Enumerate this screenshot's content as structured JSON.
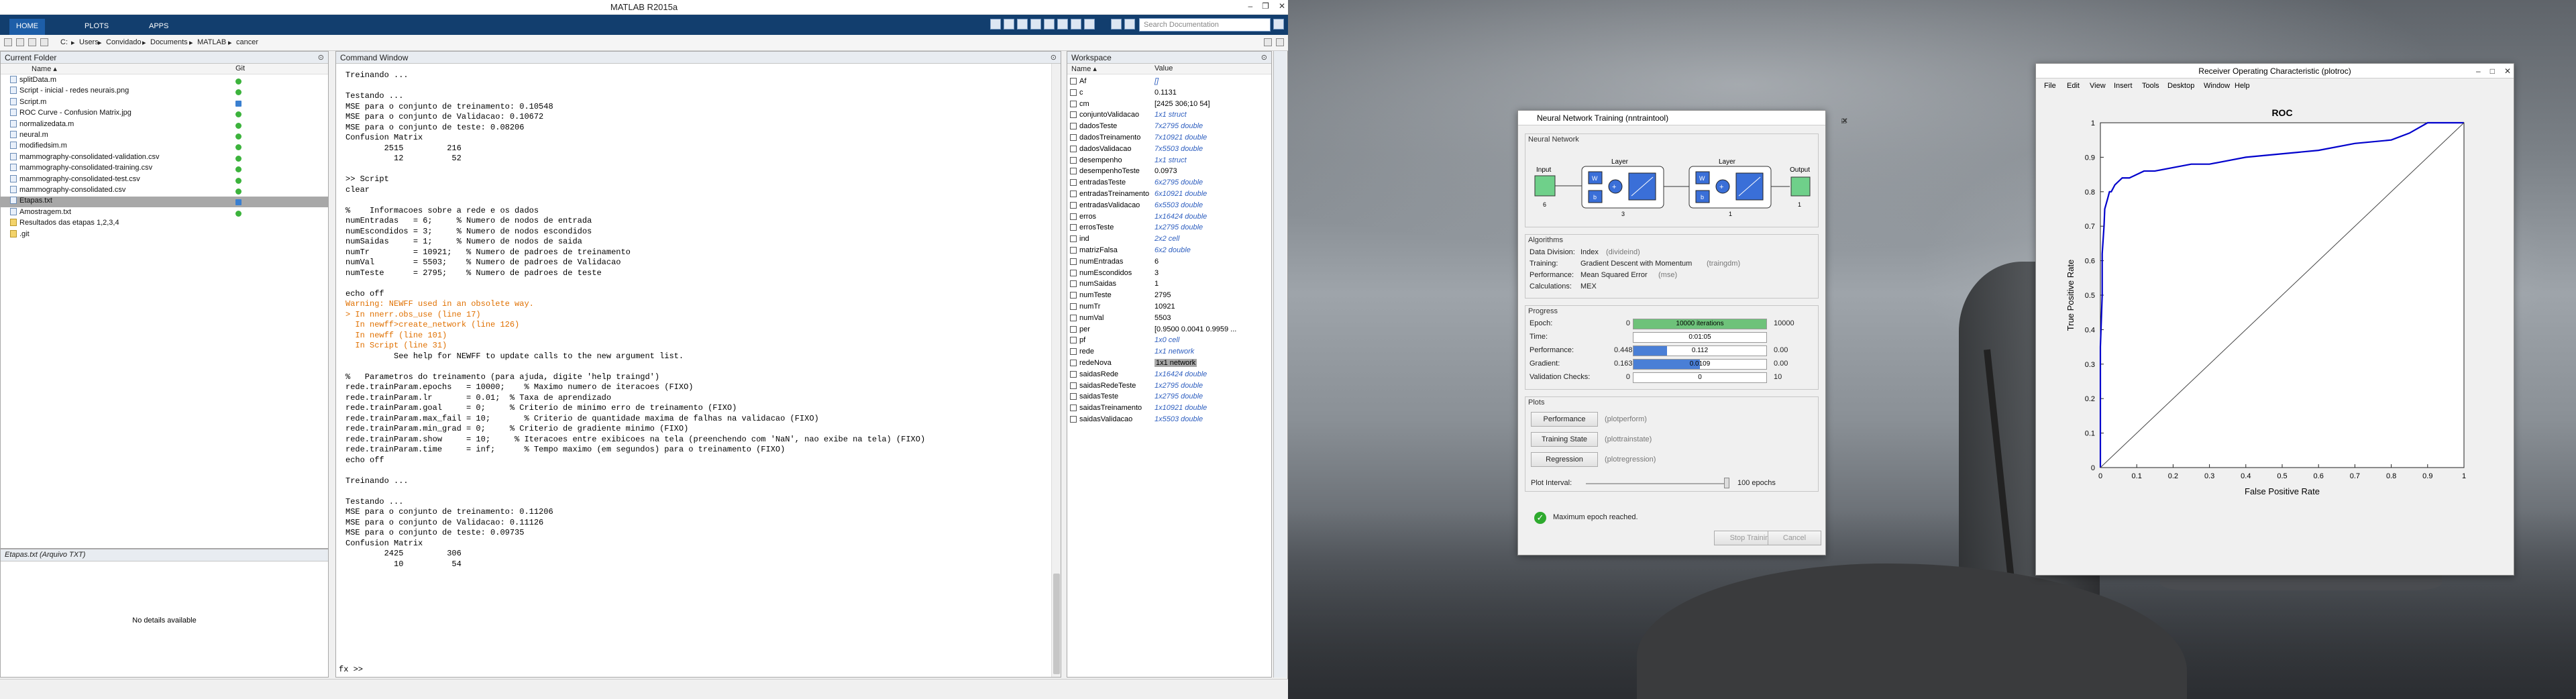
{
  "matlab": {
    "title": "MATLAB R2015a",
    "ribbon_tabs": [
      "HOME",
      "PLOTS",
      "APPS"
    ],
    "search_placeholder": "Search Documentation",
    "path": [
      "C:",
      "Users",
      "Convidado",
      "Documents",
      "MATLAB",
      "cancer"
    ],
    "current_folder": {
      "title": "Current Folder",
      "col_name": "Name ▴",
      "col_git": "Git",
      "files": [
        {
          "name": "splitData.m",
          "git": "ok"
        },
        {
          "name": "Script - inicial - redes neurais.png",
          "git": "ok"
        },
        {
          "name": "Script.m",
          "git": "mod"
        },
        {
          "name": "ROC Curve - Confusion Matrix.jpg",
          "git": "ok"
        },
        {
          "name": "normalizedata.m",
          "git": "ok"
        },
        {
          "name": "neural.m",
          "git": "ok"
        },
        {
          "name": "modifiedsim.m",
          "git": "ok"
        },
        {
          "name": "mammography-consolidated-validation.csv",
          "git": "ok"
        },
        {
          "name": "mammography-consolidated-training.csv",
          "git": "ok"
        },
        {
          "name": "mammography-consolidated-test.csv",
          "git": "ok"
        },
        {
          "name": "mammography-consolidated.csv",
          "git": "ok"
        },
        {
          "name": "Etapas.txt",
          "git": "mod",
          "selected": true
        },
        {
          "name": "Amostragem.txt",
          "git": "ok"
        },
        {
          "name": "Resultados das etapas 1,2,3,4",
          "git": "",
          "folder": true
        },
        {
          "name": ".git",
          "git": "",
          "folder": true
        }
      ],
      "details_title": "Etapas.txt (Arquivo TXT)",
      "details_text": "No details available"
    },
    "command_window": {
      "title": "Command Window",
      "prompt": "fx >>",
      "lines": [
        {
          "t": "Treinando ..."
        },
        {
          "t": ""
        },
        {
          "t": "Testando ..."
        },
        {
          "t": "MSE para o conjunto de treinamento: 0.10548"
        },
        {
          "t": "MSE para o conjunto de Validacao: 0.10672"
        },
        {
          "t": "MSE para o conjunto de teste: 0.08206"
        },
        {
          "t": "Confusion Matrix"
        },
        {
          "t": "        2515         216"
        },
        {
          "t": "          12          52"
        },
        {
          "t": ""
        },
        {
          "t": ">> Script"
        },
        {
          "t": "clear"
        },
        {
          "t": ""
        },
        {
          "t": "%    Informacoes sobre a rede e os dados"
        },
        {
          "t": "numEntradas   = 6;     % Numero de nodos de entrada"
        },
        {
          "t": "numEscondidos = 3;     % Numero de nodos escondidos"
        },
        {
          "t": "numSaidas     = 1;     % Numero de nodos de saida"
        },
        {
          "t": "numTr         = 10921;   % Numero de padroes de treinamento"
        },
        {
          "t": "numVal        = 5503;    % Numero de padroes de Validacao"
        },
        {
          "t": "numTeste      = 2795;    % Numero de padroes de teste"
        },
        {
          "t": ""
        },
        {
          "t": "echo off"
        },
        {
          "t": "Warning: NEWFF used in an obsolete way.",
          "c": "warn"
        },
        {
          "t": "> In nnerr.obs_use (line 17)",
          "c": "warn"
        },
        {
          "t": "  In newff>create_network (line 126)",
          "c": "warn"
        },
        {
          "t": "  In newff (line 101)",
          "c": "warn"
        },
        {
          "t": "  In Script (line 31)",
          "c": "warn"
        },
        {
          "t": "          See help for NEWFF to update calls to the new argument list."
        },
        {
          "t": ""
        },
        {
          "t": "%   Parametros do treinamento (para ajuda, digite 'help traingd')"
        },
        {
          "t": "rede.trainParam.epochs   = 10000;    % Maximo numero de iteracoes (FIXO)"
        },
        {
          "t": "rede.trainParam.lr       = 0.01;  % Taxa de aprendizado"
        },
        {
          "t": "rede.trainParam.goal     = 0;     % Criterio de minimo erro de treinamento (FIXO)"
        },
        {
          "t": "rede.trainParam.max_fail = 10;       % Criterio de quantidade maxima de falhas na validacao (FIXO)"
        },
        {
          "t": "rede.trainParam.min_grad = 0;     % Criterio de gradiente minimo (FIXO)"
        },
        {
          "t": "rede.trainParam.show     = 10;     % Iteracoes entre exibicoes na tela (preenchendo com 'NaN', nao exibe na tela) (FIXO)"
        },
        {
          "t": "rede.trainParam.time     = inf;      % Tempo maximo (em segundos) para o treinamento (FIXO)"
        },
        {
          "t": "echo off"
        },
        {
          "t": ""
        },
        {
          "t": "Treinando ..."
        },
        {
          "t": ""
        },
        {
          "t": "Testando ..."
        },
        {
          "t": "MSE para o conjunto de treinamento: 0.11206"
        },
        {
          "t": "MSE para o conjunto de Validacao: 0.11126"
        },
        {
          "t": "MSE para o conjunto de teste: 0.09735"
        },
        {
          "t": "Confusion Matrix"
        },
        {
          "t": "        2425         306"
        },
        {
          "t": "          10          54"
        }
      ]
    },
    "workspace": {
      "title": "Workspace",
      "col_name": "Name ▴",
      "col_value": "Value",
      "vars": [
        {
          "n": "Af",
          "v": "[]",
          "blue": true
        },
        {
          "n": "c",
          "v": "0.1131"
        },
        {
          "n": "cm",
          "v": "[2425 306;10 54]"
        },
        {
          "n": "conjuntoValidacao",
          "v": "1x1 struct",
          "blue": true
        },
        {
          "n": "dadosTeste",
          "v": "7x2795 double",
          "blue": true
        },
        {
          "n": "dadosTreinamento",
          "v": "7x10921 double",
          "blue": true
        },
        {
          "n": "dadosValidacao",
          "v": "7x5503 double",
          "blue": true
        },
        {
          "n": "desempenho",
          "v": "1x1 struct",
          "blue": true
        },
        {
          "n": "desempenhoTeste",
          "v": "0.0973"
        },
        {
          "n": "entradasTeste",
          "v": "6x2795 double",
          "blue": true
        },
        {
          "n": "entradasTreinamento",
          "v": "6x10921 double",
          "blue": true
        },
        {
          "n": "entradasValidacao",
          "v": "6x5503 double",
          "blue": true
        },
        {
          "n": "erros",
          "v": "1x16424 double",
          "blue": true
        },
        {
          "n": "errosTeste",
          "v": "1x2795 double",
          "blue": true
        },
        {
          "n": "ind",
          "v": "2x2 cell",
          "blue": true
        },
        {
          "n": "matrizFalsa",
          "v": "6x2 double",
          "blue": true
        },
        {
          "n": "numEntradas",
          "v": "6"
        },
        {
          "n": "numEscondidos",
          "v": "3"
        },
        {
          "n": "numSaidas",
          "v": "1"
        },
        {
          "n": "numTeste",
          "v": "2795"
        },
        {
          "n": "numTr",
          "v": "10921"
        },
        {
          "n": "numVal",
          "v": "5503"
        },
        {
          "n": "per",
          "v": "[0.9500 0.0041 0.9959 ..."
        },
        {
          "n": "pf",
          "v": "1x0 cell",
          "blue": true
        },
        {
          "n": "rede",
          "v": "1x1 network",
          "blue": true
        },
        {
          "n": "redeNova",
          "v": "1x1 network",
          "sel": true
        },
        {
          "n": "saidasRede",
          "v": "1x16424 double",
          "blue": true
        },
        {
          "n": "saidasRedeTeste",
          "v": "1x2795 double",
          "blue": true
        },
        {
          "n": "saidasTeste",
          "v": "1x2795 double",
          "blue": true
        },
        {
          "n": "saidasTreinamento",
          "v": "1x10921 double",
          "blue": true
        },
        {
          "n": "saidasValidacao",
          "v": "1x5503 double",
          "blue": true
        }
      ]
    }
  },
  "nntraintool": {
    "title": "Neural Network Training (nntraintool)",
    "sections": {
      "network": "Neural Network",
      "algorithms": "Algorithms",
      "progress": "Progress",
      "plots": "Plots"
    },
    "diagram": {
      "input": "Input",
      "input_n": "6",
      "layer1": "Layer",
      "layer1_n": "3",
      "layer2": "Layer",
      "layer2_n": "1",
      "output": "Output",
      "output_n": "1",
      "w": "W",
      "b": "b"
    },
    "algorithms": [
      {
        "label": "Data Division:",
        "value": "Index",
        "note": "(divideind)"
      },
      {
        "label": "Training:",
        "value": "Gradient Descent with Momentum",
        "note": "(traingdm)"
      },
      {
        "label": "Performance:",
        "value": "Mean Squared Error",
        "note": "(mse)"
      },
      {
        "label": "Calculations:",
        "value": "MEX",
        "note": ""
      }
    ],
    "progress": [
      {
        "label": "Epoch:",
        "min": "0",
        "value": "10000 iterations",
        "max": "10000",
        "fill": 1.0,
        "color": "#6ec27a"
      },
      {
        "label": "Time:",
        "min": "",
        "value": "0:01:05",
        "max": "",
        "fill": 0,
        "color": "#fff"
      },
      {
        "label": "Performance:",
        "min": "0.448",
        "value": "0.112",
        "max": "0.00",
        "fill": 0.25,
        "color": "#4a7fd6"
      },
      {
        "label": "Gradient:",
        "min": "0.163",
        "value": "0.0109",
        "max": "0.00",
        "fill": 0.5,
        "color": "#4a7fd6"
      },
      {
        "label": "Validation Checks:",
        "min": "0",
        "value": "0",
        "max": "10",
        "fill": 0,
        "color": "#fff"
      }
    ],
    "plots": [
      {
        "label": "Performance",
        "fn": "(plotperform)"
      },
      {
        "label": "Training State",
        "fn": "(plottrainstate)"
      },
      {
        "label": "Regression",
        "fn": "(plotregression)"
      }
    ],
    "plot_interval_label": "Plot Interval:",
    "plot_interval_value": "100 epochs",
    "status": "Maximum epoch reached.",
    "stop_button": "Stop Training",
    "cancel_button": "Cancel"
  },
  "plotroc": {
    "title": "Receiver Operating Characteristic (plotroc)",
    "menu": [
      "File",
      "Edit",
      "View",
      "Insert",
      "Tools",
      "Desktop",
      "Window",
      "Help"
    ]
  },
  "chart_data": {
    "type": "line",
    "title": "ROC",
    "xlabel": "False Positive Rate",
    "ylabel": "True Positive Rate",
    "xlim": [
      0,
      1
    ],
    "ylim": [
      0,
      1
    ],
    "xticks": [
      "0",
      "0.1",
      "0.2",
      "0.3",
      "0.4",
      "0.5",
      "0.6",
      "0.7",
      "0.8",
      "0.9",
      "1"
    ],
    "yticks": [
      "0",
      "0.1",
      "0.2",
      "0.3",
      "0.4",
      "0.5",
      "0.6",
      "0.7",
      "0.8",
      "0.9",
      "1"
    ],
    "series": [
      {
        "color": "#0000cc",
        "x": [
          0,
          0,
          0.005,
          0.005,
          0.01,
          0.012,
          0.02,
          0.025,
          0.03,
          0.04,
          0.05,
          0.06,
          0.08,
          0.1,
          0.12,
          0.15,
          0.2,
          0.25,
          0.3,
          0.35,
          0.4,
          0.5,
          0.6,
          0.7,
          0.8,
          0.85,
          0.9,
          1
        ],
        "y": [
          0,
          0.35,
          0.5,
          0.62,
          0.7,
          0.75,
          0.78,
          0.8,
          0.8,
          0.82,
          0.83,
          0.84,
          0.84,
          0.85,
          0.86,
          0.86,
          0.87,
          0.88,
          0.88,
          0.89,
          0.9,
          0.91,
          0.92,
          0.94,
          0.95,
          0.97,
          1,
          1
        ]
      },
      {
        "color": "#444444",
        "x": [
          0,
          1
        ],
        "y": [
          0,
          1
        ]
      }
    ]
  },
  "colors": {
    "ribbon": "#123e6e",
    "warning": "#e07000",
    "roc_curve": "#0000cc",
    "epoch_bar": "#6ec27a",
    "bar_blue": "#4a7fd6"
  }
}
